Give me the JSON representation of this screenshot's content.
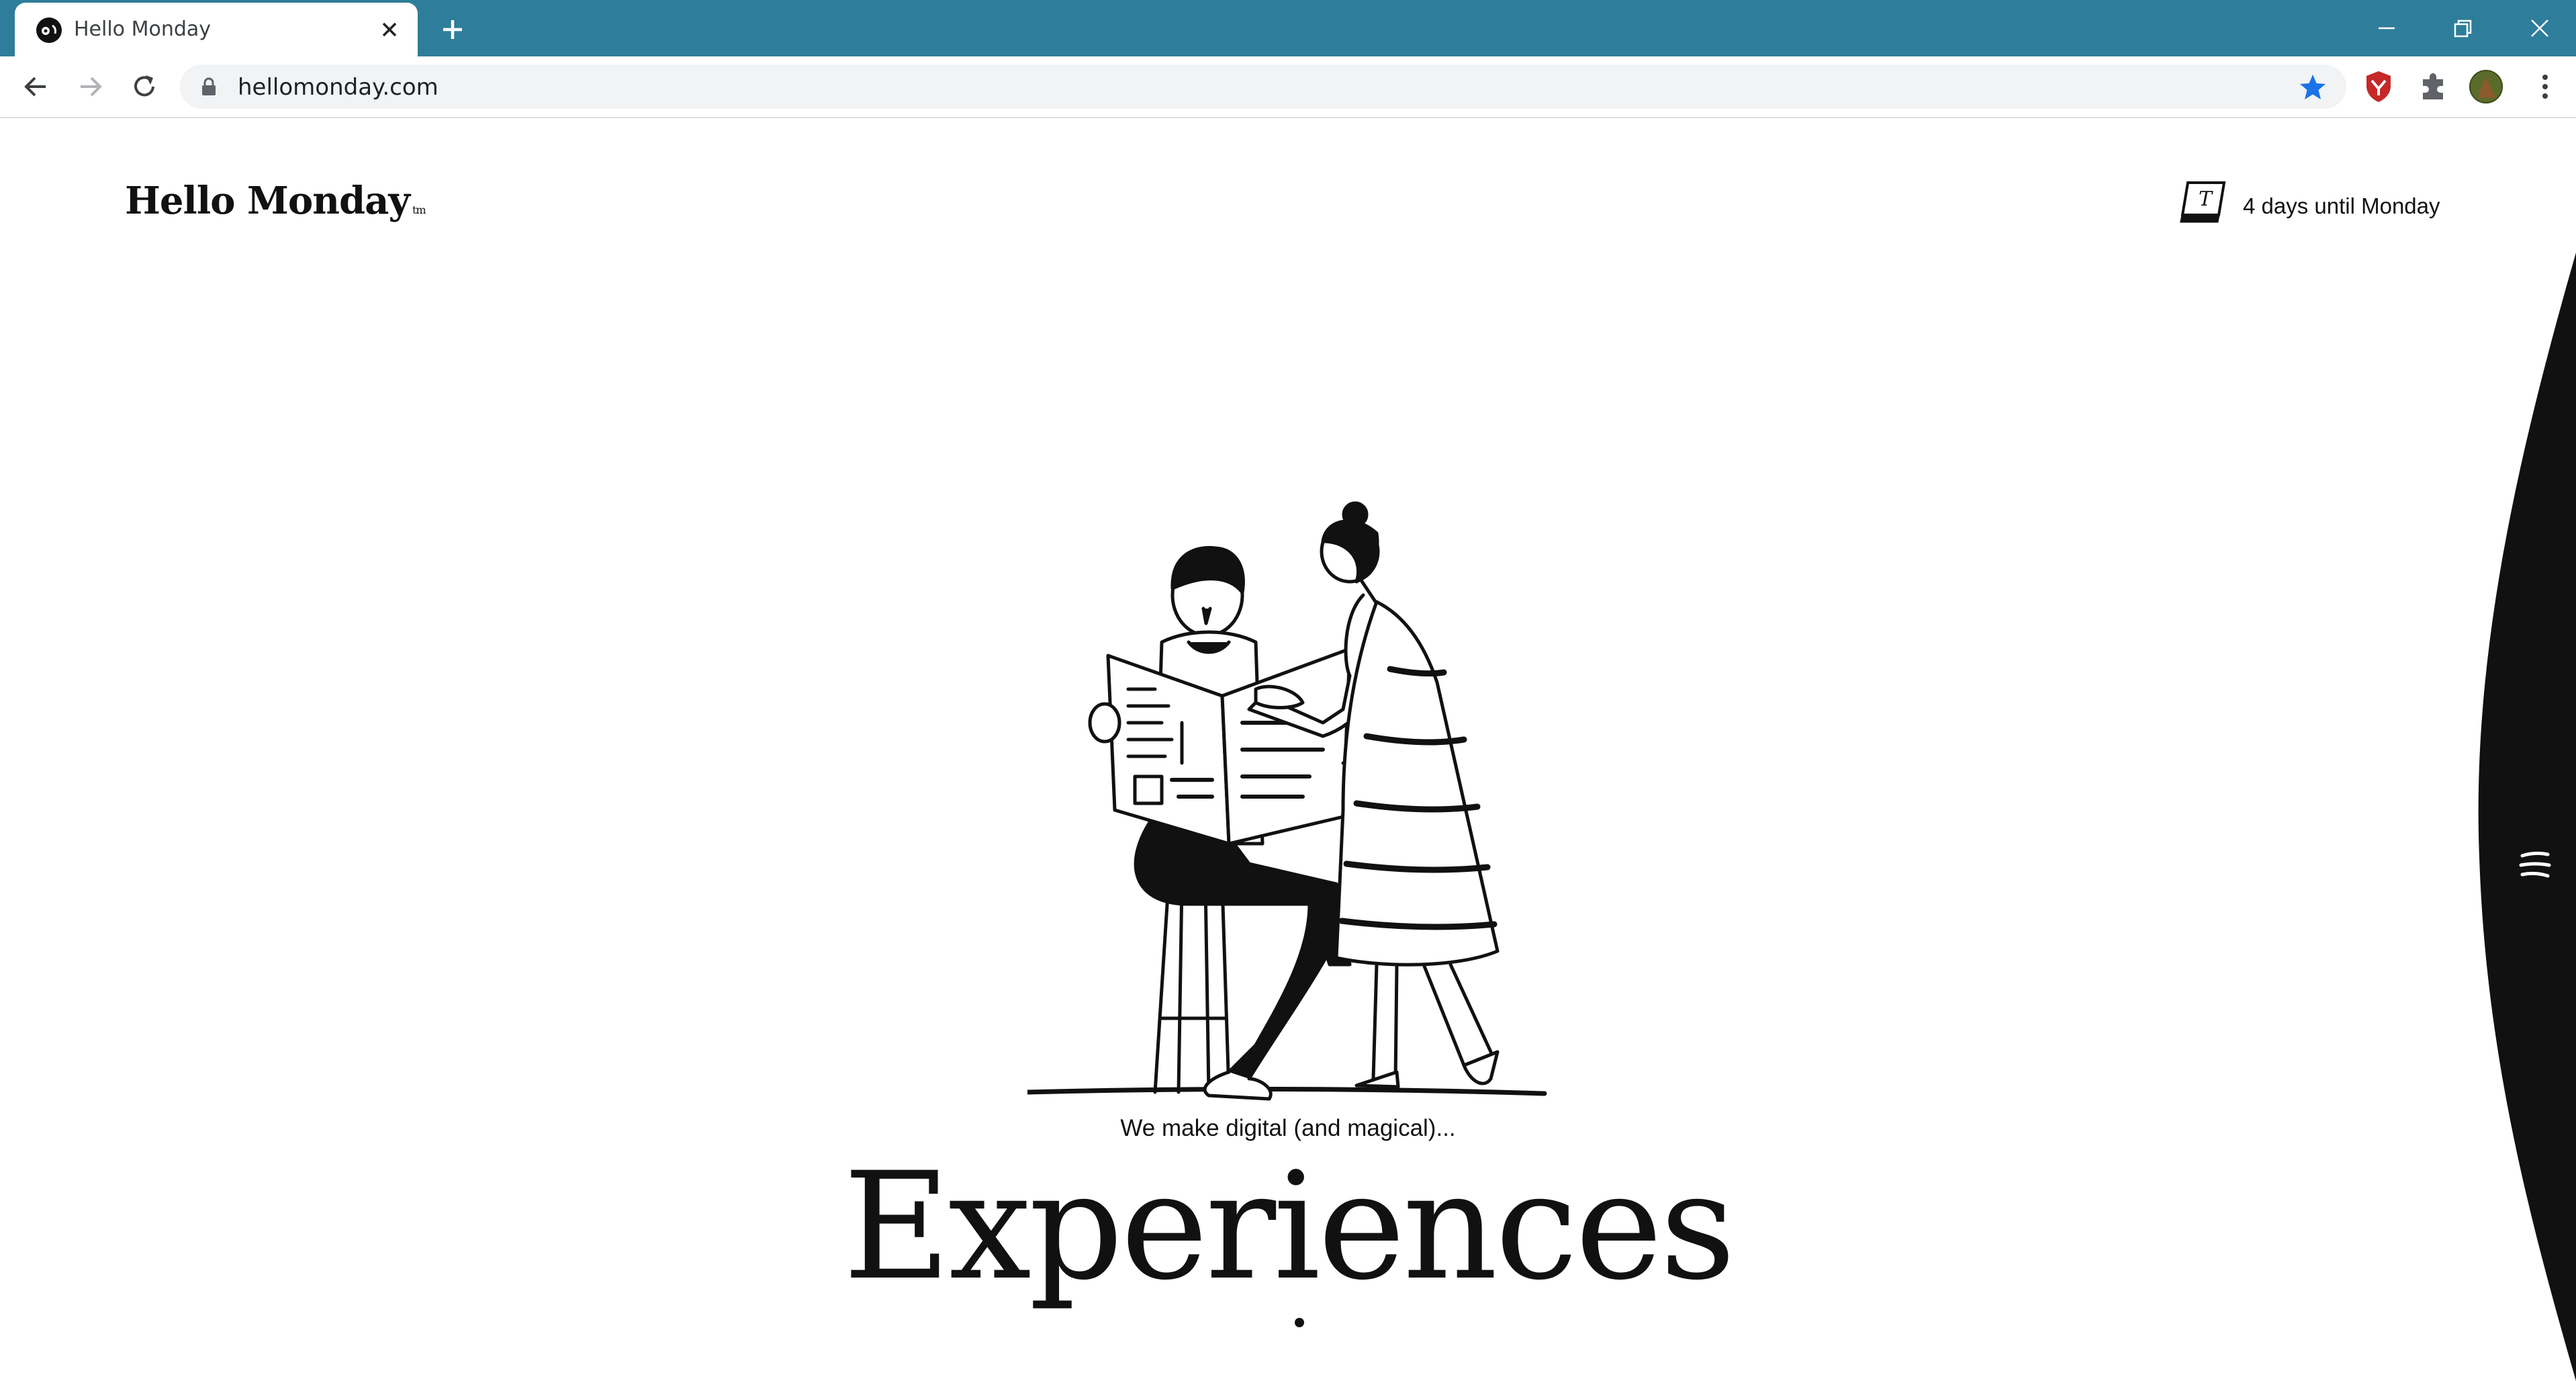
{
  "browser": {
    "tab_title": "Hello Monday",
    "url": "hellomonday.com",
    "colors": {
      "titlebar": "#2e7d9a",
      "bookmark_star": "#1a73e8"
    }
  },
  "site": {
    "logo_text": "Hello Monday",
    "logo_mark": "tm",
    "countdown_text": "4 days until Monday",
    "tagline": "We make digital (and magical)...",
    "headline": "Experiences"
  },
  "icons": {
    "favicon": "hello-monday-face-icon",
    "calendar": "tear-off-calendar-icon",
    "menu": "hamburger-menu-icon"
  }
}
